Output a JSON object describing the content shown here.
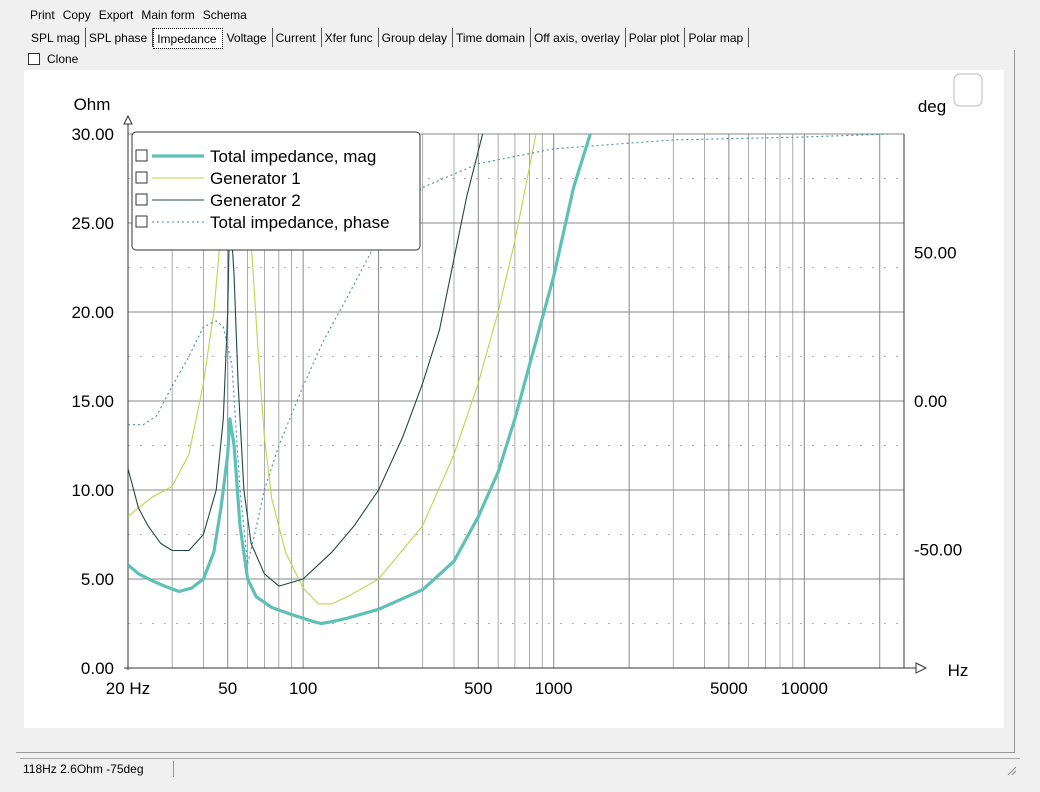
{
  "menu": [
    "Print",
    "Copy",
    "Export",
    "Main form",
    "Schema"
  ],
  "tabs": [
    {
      "label": "SPL mag",
      "active": false
    },
    {
      "label": "SPL phase",
      "active": false
    },
    {
      "label": "Impedance",
      "active": true
    },
    {
      "label": "Voltage",
      "active": false
    },
    {
      "label": "Current",
      "active": false
    },
    {
      "label": "Xfer func",
      "active": false
    },
    {
      "label": "Group delay",
      "active": false
    },
    {
      "label": "Time domain",
      "active": false
    },
    {
      "label": "Off axis, overlay",
      "active": false
    },
    {
      "label": "Polar plot",
      "active": false
    },
    {
      "label": "Polar map",
      "active": false
    }
  ],
  "clone": {
    "label": "Clone",
    "checked": false
  },
  "status": {
    "text": "118Hz 2.6Ohm -75deg"
  },
  "colors": {
    "total_mag": "#5fc0b8",
    "gen1": "#b8d84a",
    "gen2": "#1e4a40",
    "phase": "#3b8fb0",
    "grid": "#888888"
  },
  "chart_data": {
    "type": "line",
    "ylabel_left": "Ohm",
    "ylabel_right": "deg",
    "xlabel": "Hz",
    "xscale": "log",
    "xlim": [
      20,
      25000
    ],
    "ylim_left": [
      0,
      30
    ],
    "ylim_right": [
      -90,
      90
    ],
    "x_ticks": [
      {
        "v": 20,
        "label": "20 Hz"
      },
      {
        "v": 50,
        "label": "50"
      },
      {
        "v": 100,
        "label": "100"
      },
      {
        "v": 500,
        "label": "500"
      },
      {
        "v": 1000,
        "label": "1000"
      },
      {
        "v": 5000,
        "label": "5000"
      },
      {
        "v": 10000,
        "label": "10000"
      }
    ],
    "y_left_ticks": [
      {
        "v": 0,
        "label": "0.00"
      },
      {
        "v": 5,
        "label": "5.00"
      },
      {
        "v": 10,
        "label": "10.00"
      },
      {
        "v": 15,
        "label": "15.00"
      },
      {
        "v": 20,
        "label": "20.00"
      },
      {
        "v": 25,
        "label": "25.00"
      },
      {
        "v": 30,
        "label": "30.00"
      }
    ],
    "y_right_ticks": [
      {
        "v": 50,
        "label": "50.00"
      },
      {
        "v": 0,
        "label": "0.00"
      },
      {
        "v": -50,
        "label": "-50.00"
      }
    ],
    "grid": true,
    "legend_position": "top-left",
    "series": [
      {
        "name": "Total impedance, mag",
        "axis": "left",
        "style": "thick",
        "points": [
          [
            20,
            5.8
          ],
          [
            22,
            5.3
          ],
          [
            25,
            4.9
          ],
          [
            28,
            4.6
          ],
          [
            32,
            4.3
          ],
          [
            36,
            4.5
          ],
          [
            40,
            5.0
          ],
          [
            44,
            6.5
          ],
          [
            47,
            9.0
          ],
          [
            50,
            12.0
          ],
          [
            51,
            14.0
          ],
          [
            53,
            12.5
          ],
          [
            56,
            8.0
          ],
          [
            60,
            5.0
          ],
          [
            65,
            4.0
          ],
          [
            75,
            3.4
          ],
          [
            90,
            3.0
          ],
          [
            100,
            2.8
          ],
          [
            110,
            2.6
          ],
          [
            118,
            2.5
          ],
          [
            130,
            2.6
          ],
          [
            150,
            2.8
          ],
          [
            200,
            3.3
          ],
          [
            300,
            4.4
          ],
          [
            400,
            6.0
          ],
          [
            500,
            8.5
          ],
          [
            600,
            11.0
          ],
          [
            700,
            14.0
          ],
          [
            800,
            17.0
          ],
          [
            1000,
            22.0
          ],
          [
            1200,
            27.0
          ],
          [
            1400,
            30.0
          ]
        ]
      },
      {
        "name": "Generator 1",
        "axis": "left",
        "style": "thin",
        "points": [
          [
            20,
            8.5
          ],
          [
            22,
            9.0
          ],
          [
            25,
            9.6
          ],
          [
            30,
            10.2
          ],
          [
            35,
            12.0
          ],
          [
            40,
            16.0
          ],
          [
            44,
            20.0
          ],
          [
            48,
            26.0
          ],
          [
            50,
            30.0
          ],
          [
            58,
            30.0
          ],
          [
            62,
            24.0
          ],
          [
            66,
            18.0
          ],
          [
            70,
            13.0
          ],
          [
            75,
            9.5
          ],
          [
            85,
            6.5
          ],
          [
            100,
            4.5
          ],
          [
            115,
            3.6
          ],
          [
            130,
            3.6
          ],
          [
            150,
            4.0
          ],
          [
            200,
            5.0
          ],
          [
            300,
            8.0
          ],
          [
            400,
            12.0
          ],
          [
            500,
            16.0
          ],
          [
            600,
            20.0
          ],
          [
            700,
            24.0
          ],
          [
            850,
            30.0
          ]
        ]
      },
      {
        "name": "Generator 2",
        "axis": "left",
        "style": "thin",
        "points": [
          [
            20,
            11.2
          ],
          [
            22,
            9.0
          ],
          [
            24,
            8.0
          ],
          [
            27,
            7.0
          ],
          [
            30,
            6.6
          ],
          [
            35,
            6.6
          ],
          [
            40,
            7.5
          ],
          [
            45,
            10.0
          ],
          [
            48,
            14.0
          ],
          [
            50,
            20.0
          ],
          [
            51,
            26.0
          ],
          [
            53,
            22.0
          ],
          [
            55,
            16.0
          ],
          [
            58,
            10.0
          ],
          [
            62,
            7.0
          ],
          [
            70,
            5.3
          ],
          [
            80,
            4.6
          ],
          [
            100,
            5.0
          ],
          [
            130,
            6.5
          ],
          [
            160,
            8.0
          ],
          [
            200,
            10.0
          ],
          [
            250,
            13.0
          ],
          [
            300,
            16.0
          ],
          [
            350,
            19.0
          ],
          [
            400,
            23.0
          ],
          [
            450,
            26.5
          ],
          [
            520,
            30.0
          ]
        ]
      },
      {
        "name": "Total impedance, phase",
        "axis": "right",
        "style": "dotted",
        "points": [
          [
            20,
            -8
          ],
          [
            23,
            -8
          ],
          [
            26,
            -5
          ],
          [
            30,
            5
          ],
          [
            35,
            15
          ],
          [
            40,
            25
          ],
          [
            45,
            27
          ],
          [
            48,
            25
          ],
          [
            52,
            12
          ],
          [
            56,
            -30
          ],
          [
            60,
            -55
          ],
          [
            64,
            -45
          ],
          [
            70,
            -30
          ],
          [
            80,
            -15
          ],
          [
            100,
            5
          ],
          [
            120,
            20
          ],
          [
            150,
            35
          ],
          [
            200,
            55
          ],
          [
            300,
            72
          ],
          [
            500,
            80
          ],
          [
            1000,
            85
          ],
          [
            3000,
            88
          ],
          [
            10000,
            89
          ],
          [
            22000,
            90
          ]
        ]
      }
    ]
  }
}
